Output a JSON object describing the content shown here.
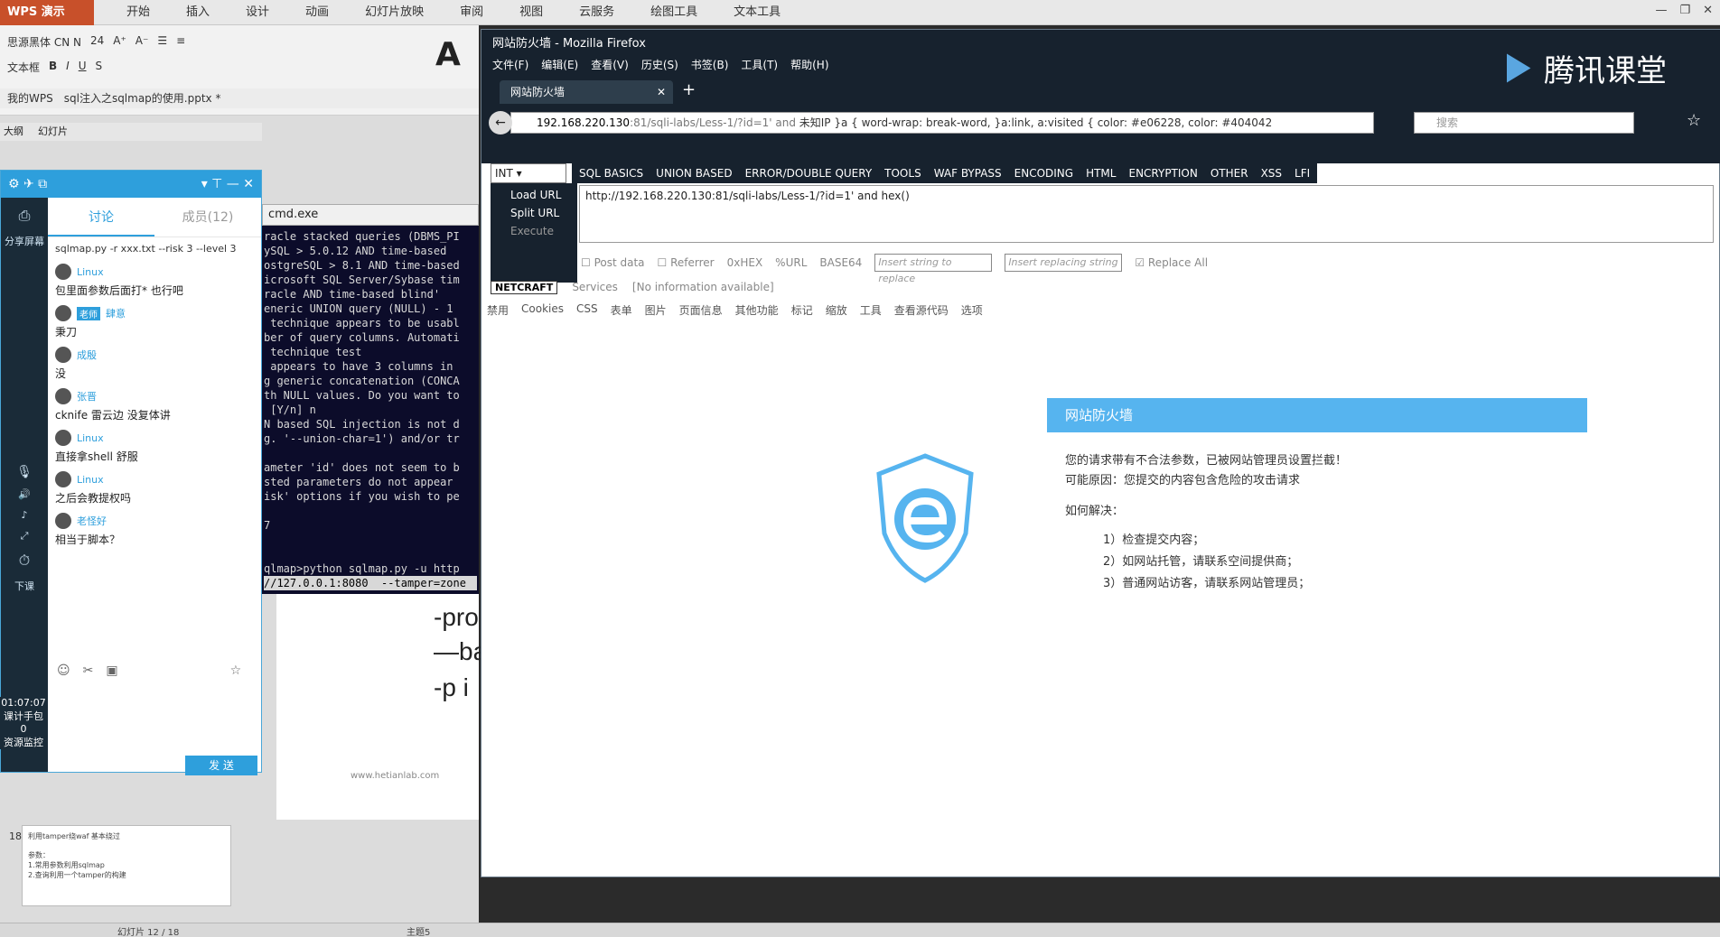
{
  "wps": {
    "logo": "WPS 演示",
    "menu": [
      "开始",
      "插入",
      "设计",
      "动画",
      "幻灯片放映",
      "审阅",
      "视图",
      "云服务",
      "绘图工具",
      "文本工具"
    ],
    "font_name": "思源黑体 CN N",
    "font_size": "24",
    "textbox_label": "文本框",
    "big_letter": "A",
    "doc_tabs": [
      "我的WPS",
      "sql注入之sqlmap的使用.pptx *"
    ],
    "panel_tabs": [
      "大纲",
      "幻灯片"
    ],
    "slide_number": "18",
    "thumb_title": "利用tamper绕waf 基本绕过",
    "thumb_lines": [
      "参数：",
      "1.常用参数利用sqlmap",
      "2.查询利用一个tamper的构建"
    ],
    "slide_lines": [
      "-pro",
      "—ba",
      "-p  i"
    ],
    "watermark": "www.hetianlab.com",
    "status": [
      "幻灯片 12 / 18",
      "主题5"
    ]
  },
  "qq": {
    "side_items": [
      "分享屏幕",
      "下课",
      "01:07:07",
      "课计手包",
      "0",
      "资源监控"
    ],
    "tabs": [
      "讨论",
      "成员(12)"
    ],
    "cmd_line": "sqlmap.py -r xxx.txt --risk 3 --level 3",
    "messages": [
      {
        "name": "Linux",
        "text": "包里面参数后面打* 也行吧",
        "badge": ""
      },
      {
        "name": "肆意",
        "text": "秉刀",
        "badge": "老师"
      },
      {
        "name": "成殷",
        "text": "没",
        "badge": ""
      },
      {
        "name": "张晋",
        "text": "cknife 雷云边 没复体讲",
        "badge": ""
      },
      {
        "name": "Linux",
        "text": "直接拿shell 舒服",
        "badge": ""
      },
      {
        "name": "Linux",
        "text": "之后会教提权吗",
        "badge": ""
      },
      {
        "name": "老怪好",
        "text": "相当于脚本？",
        "badge": ""
      }
    ],
    "send_label": "发 送"
  },
  "cmd": {
    "title": "cmd.exe",
    "lines": [
      "racle stacked queries (DBMS_PI",
      "ySQL > 5.0.12 AND time-based",
      "ostgreSQL > 8.1 AND time-based",
      "icrosoft SQL Server/Sybase tim",
      "racle AND time-based blind'",
      "eneric UNION query (NULL) - 1",
      " technique appears to be usabl",
      "ber of query columns. Automati",
      " technique test",
      " appears to have 3 columns in",
      "g generic concatenation (CONCA",
      "th NULL values. Do you want to",
      " [Y/n] n",
      "N based SQL injection is not d",
      "g. '--union-char=1') and/or tr",
      "",
      "ameter 'id' does not seem to b",
      "sted parameters do not appear",
      "isk' options if you wish to pe",
      "",
      "7",
      "",
      "",
      "qlmap>python sqlmap.py -u http",
      "//127.0.0.1:8080  --tamper=zone"
    ]
  },
  "firefox": {
    "title": "网站防火墙 - Mozilla Firefox",
    "menu": [
      "文件(F)",
      "编辑(E)",
      "查看(V)",
      "历史(S)",
      "书签(B)",
      "工具(T)",
      "帮助(H)"
    ],
    "tab_title": "网站防火墙",
    "brand": "腾讯课堂",
    "url_host": "192.168.220.130",
    "url_rest": ":81/sqli-labs/Less-1/?id=1' and",
    "url_tail": "      未知IP    }a { word-wrap: break-word, }a:link, a:visited { color: #e06228, color: #404042",
    "search_placeholder": "搜索"
  },
  "hackbar": {
    "select_value": "INT",
    "menu": [
      "SQL BASICS",
      "UNION BASED",
      "ERROR/DOUBLE QUERY",
      "TOOLS",
      "WAF BYPASS",
      "ENCODING",
      "HTML",
      "ENCRYPTION",
      "OTHER",
      "XSS",
      "LFI"
    ],
    "left_buttons": [
      "Load URL",
      "Split URL",
      "Execute"
    ],
    "url_value": "http://192.168.220.130:81/sqli-labs/Less-1/?id=1' and hex()",
    "options": [
      "Post data",
      "Referrer",
      "0xHEX",
      "%URL",
      "BASE64"
    ],
    "replace_placeholder_1": "Insert string to replace",
    "replace_placeholder_2": "Insert replacing string",
    "replace_all": "Replace All",
    "netcraft": "NETCRAFT",
    "services": "Services",
    "no_info": "[No information available]",
    "toolbar3": [
      "禁用",
      "Cookies",
      "CSS",
      "表单",
      "图片",
      "页面信息",
      "其他功能",
      "标记",
      "缩放",
      "工具",
      "查看源代码",
      "选项"
    ]
  },
  "waf": {
    "banner": "网站防火墙",
    "line1": "您的请求带有不合法参数，已被网站管理员设置拦截！",
    "line2": "可能原因：您提交的内容包含危险的攻击请求",
    "how": "如何解决：",
    "steps": [
      "1）检查提交内容；",
      "2）如网站托管，请联系空间提供商；",
      "3）普通网站访客，请联系网站管理员；"
    ],
    "logo_color": "#56b4ef"
  }
}
